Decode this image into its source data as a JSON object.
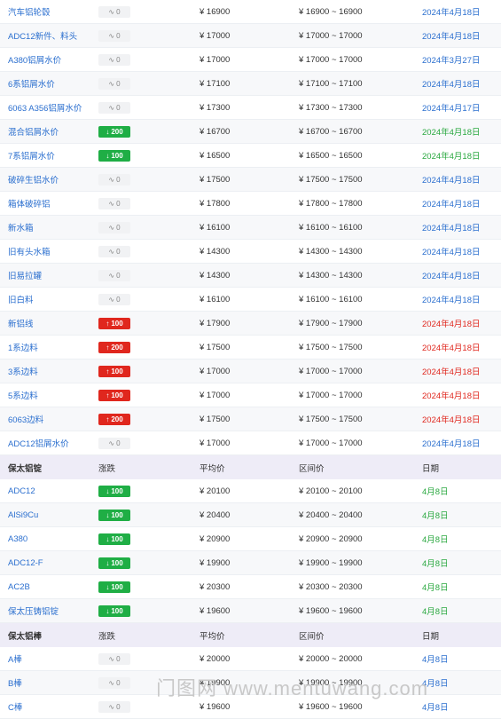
{
  "section1": {
    "rows": [
      {
        "name": "汽车铝轮毂",
        "change": "0",
        "dir": "flat",
        "avg": "¥ 16900",
        "range": "¥ 16900 ~ 16900",
        "date": "2024年4月18日",
        "date_color": "blue"
      },
      {
        "name": "ADC12新件、料头",
        "change": "0",
        "dir": "flat",
        "avg": "¥ 17000",
        "range": "¥ 17000 ~ 17000",
        "date": "2024年4月18日",
        "date_color": "blue"
      },
      {
        "name": "A380铝屑水价",
        "change": "0",
        "dir": "flat",
        "avg": "¥ 17000",
        "range": "¥ 17000 ~ 17000",
        "date": "2024年3月27日",
        "date_color": "blue"
      },
      {
        "name": "6系铝屑水价",
        "change": "0",
        "dir": "flat",
        "avg": "¥ 17100",
        "range": "¥ 17100 ~ 17100",
        "date": "2024年4月18日",
        "date_color": "blue"
      },
      {
        "name": "6063 A356铝屑水价",
        "change": "0",
        "dir": "flat",
        "avg": "¥ 17300",
        "range": "¥ 17300 ~ 17300",
        "date": "2024年4月17日",
        "date_color": "blue"
      },
      {
        "name": "混合铝屑水价",
        "change": "200",
        "dir": "down",
        "avg": "¥ 16700",
        "range": "¥ 16700 ~ 16700",
        "date": "2024年4月18日",
        "date_color": "green"
      },
      {
        "name": "7系铝屑水价",
        "change": "100",
        "dir": "down",
        "avg": "¥ 16500",
        "range": "¥ 16500 ~ 16500",
        "date": "2024年4月18日",
        "date_color": "green"
      },
      {
        "name": "破碎生铝水价",
        "change": "0",
        "dir": "flat",
        "avg": "¥ 17500",
        "range": "¥ 17500 ~ 17500",
        "date": "2024年4月18日",
        "date_color": "blue"
      },
      {
        "name": "箱体破碎铝",
        "change": "0",
        "dir": "flat",
        "avg": "¥ 17800",
        "range": "¥ 17800 ~ 17800",
        "date": "2024年4月18日",
        "date_color": "blue"
      },
      {
        "name": "新水箱",
        "change": "0",
        "dir": "flat",
        "avg": "¥ 16100",
        "range": "¥ 16100 ~ 16100",
        "date": "2024年4月18日",
        "date_color": "blue"
      },
      {
        "name": "旧有头水箱",
        "change": "0",
        "dir": "flat",
        "avg": "¥ 14300",
        "range": "¥ 14300 ~ 14300",
        "date": "2024年4月18日",
        "date_color": "blue"
      },
      {
        "name": "旧易拉罐",
        "change": "0",
        "dir": "flat",
        "avg": "¥ 14300",
        "range": "¥ 14300 ~ 14300",
        "date": "2024年4月18日",
        "date_color": "blue"
      },
      {
        "name": "旧白料",
        "change": "0",
        "dir": "flat",
        "avg": "¥ 16100",
        "range": "¥ 16100 ~ 16100",
        "date": "2024年4月18日",
        "date_color": "blue"
      },
      {
        "name": "新铝线",
        "change": "100",
        "dir": "up",
        "avg": "¥ 17900",
        "range": "¥ 17900 ~ 17900",
        "date": "2024年4月18日",
        "date_color": "red"
      },
      {
        "name": "1系边料",
        "change": "200",
        "dir": "up",
        "avg": "¥ 17500",
        "range": "¥ 17500 ~ 17500",
        "date": "2024年4月18日",
        "date_color": "red"
      },
      {
        "name": "3系边料",
        "change": "100",
        "dir": "up",
        "avg": "¥ 17000",
        "range": "¥ 17000 ~ 17000",
        "date": "2024年4月18日",
        "date_color": "red"
      },
      {
        "name": "5系边料",
        "change": "100",
        "dir": "up",
        "avg": "¥ 17000",
        "range": "¥ 17000 ~ 17000",
        "date": "2024年4月18日",
        "date_color": "red"
      },
      {
        "name": "6063边料",
        "change": "200",
        "dir": "up",
        "avg": "¥ 17500",
        "range": "¥ 17500 ~ 17500",
        "date": "2024年4月18日",
        "date_color": "red"
      },
      {
        "name": "ADC12铝屑水价",
        "change": "0",
        "dir": "flat",
        "avg": "¥ 17000",
        "range": "¥ 17000 ~ 17000",
        "date": "2024年4月18日",
        "date_color": "blue"
      }
    ]
  },
  "section2": {
    "header": {
      "name": "保太铝锭",
      "change": "涨跌",
      "avg": "平均价",
      "range": "区间价",
      "date": "日期"
    },
    "rows": [
      {
        "name": "ADC12",
        "change": "100",
        "dir": "down",
        "avg": "¥ 20100",
        "range": "¥ 20100 ~ 20100",
        "date": "4月8日",
        "date_color": "green"
      },
      {
        "name": "AlSi9Cu",
        "change": "100",
        "dir": "down",
        "avg": "¥ 20400",
        "range": "¥ 20400 ~ 20400",
        "date": "4月8日",
        "date_color": "green"
      },
      {
        "name": "A380",
        "change": "100",
        "dir": "down",
        "avg": "¥ 20900",
        "range": "¥ 20900 ~ 20900",
        "date": "4月8日",
        "date_color": "green"
      },
      {
        "name": "ADC12-F",
        "change": "100",
        "dir": "down",
        "avg": "¥ 19900",
        "range": "¥ 19900 ~ 19900",
        "date": "4月8日",
        "date_color": "green"
      },
      {
        "name": "AC2B",
        "change": "100",
        "dir": "down",
        "avg": "¥ 20300",
        "range": "¥ 20300 ~ 20300",
        "date": "4月8日",
        "date_color": "green"
      },
      {
        "name": "保太压铸铝锭",
        "change": "100",
        "dir": "down",
        "avg": "¥ 19600",
        "range": "¥ 19600 ~ 19600",
        "date": "4月8日",
        "date_color": "green"
      }
    ]
  },
  "section3": {
    "header": {
      "name": "保太铝棒",
      "change": "涨跌",
      "avg": "平均价",
      "range": "区间价",
      "date": "日期"
    },
    "rows": [
      {
        "name": "A棒",
        "change": "0",
        "dir": "flat",
        "avg": "¥ 20000",
        "range": "¥ 20000 ~ 20000",
        "date": "4月8日",
        "date_color": "blue"
      },
      {
        "name": "B棒",
        "change": "0",
        "dir": "flat",
        "avg": "¥ 19900",
        "range": "¥ 19900 ~ 19900",
        "date": "4月8日",
        "date_color": "blue"
      },
      {
        "name": "C棒",
        "change": "0",
        "dir": "flat",
        "avg": "¥ 19600",
        "range": "¥ 19600 ~ 19600",
        "date": "4月8日",
        "date_color": "blue"
      }
    ]
  },
  "icons": {
    "flat": "∿",
    "down": "↓",
    "up": "↑"
  },
  "watermark": "门图网 www.mentuwang.com"
}
